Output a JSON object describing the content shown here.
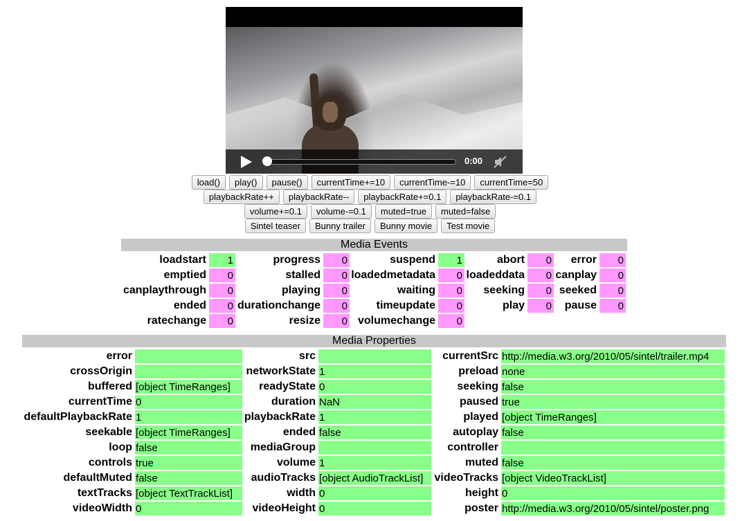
{
  "video": {
    "time": "0:00"
  },
  "buttons": {
    "row1": [
      "load()",
      "play()",
      "pause()",
      "currentTime+=10",
      "currentTime-=10",
      "currentTime=50"
    ],
    "row2": [
      "playbackRate++",
      "playbackRate--",
      "playbackRate+=0.1",
      "playbackRate-=0.1"
    ],
    "row3": [
      "volume+=0.1",
      "volume-=0.1",
      "muted=true",
      "muted=false"
    ],
    "row4": [
      "Sintel teaser",
      "Bunny trailer",
      "Bunny movie",
      "Test movie"
    ]
  },
  "events": {
    "title": "Media Events",
    "rows": [
      [
        [
          "loadstart",
          "1",
          "green"
        ],
        [
          "progress",
          "0",
          "pink"
        ],
        [
          "suspend",
          "1",
          "green"
        ],
        [
          "abort",
          "0",
          "pink"
        ],
        [
          "error",
          "0",
          "pink"
        ]
      ],
      [
        [
          "emptied",
          "0",
          "pink"
        ],
        [
          "stalled",
          "0",
          "pink"
        ],
        [
          "loadedmetadata",
          "0",
          "pink"
        ],
        [
          "loadeddata",
          "0",
          "pink"
        ],
        [
          "canplay",
          "0",
          "pink"
        ]
      ],
      [
        [
          "canplaythrough",
          "0",
          "pink"
        ],
        [
          "playing",
          "0",
          "pink"
        ],
        [
          "waiting",
          "0",
          "pink"
        ],
        [
          "seeking",
          "0",
          "pink"
        ],
        [
          "seeked",
          "0",
          "pink"
        ]
      ],
      [
        [
          "ended",
          "0",
          "pink"
        ],
        [
          "durationchange",
          "0",
          "pink"
        ],
        [
          "timeupdate",
          "0",
          "pink"
        ],
        [
          "play",
          "0",
          "pink"
        ],
        [
          "pause",
          "0",
          "pink"
        ]
      ],
      [
        [
          "ratechange",
          "0",
          "pink"
        ],
        [
          "resize",
          "0",
          "pink"
        ],
        [
          "volumechange",
          "0",
          "pink"
        ]
      ]
    ]
  },
  "properties": {
    "title": "Media Properties",
    "rows": [
      [
        [
          "error",
          ""
        ],
        [
          "src",
          ""
        ],
        [
          "currentSrc",
          "http://media.w3.org/2010/05/sintel/trailer.mp4"
        ]
      ],
      [
        [
          "crossOrigin",
          ""
        ],
        [
          "networkState",
          "1"
        ],
        [
          "preload",
          "none"
        ]
      ],
      [
        [
          "buffered",
          "[object TimeRanges]"
        ],
        [
          "readyState",
          "0"
        ],
        [
          "seeking",
          "false"
        ]
      ],
      [
        [
          "currentTime",
          "0"
        ],
        [
          "duration",
          "NaN"
        ],
        [
          "paused",
          "true"
        ]
      ],
      [
        [
          "defaultPlaybackRate",
          "1"
        ],
        [
          "playbackRate",
          "1"
        ],
        [
          "played",
          "[object TimeRanges]"
        ]
      ],
      [
        [
          "seekable",
          "[object TimeRanges]"
        ],
        [
          "ended",
          "false"
        ],
        [
          "autoplay",
          "false"
        ]
      ],
      [
        [
          "loop",
          "false"
        ],
        [
          "mediaGroup",
          ""
        ],
        [
          "controller",
          ""
        ]
      ],
      [
        [
          "controls",
          "true"
        ],
        [
          "volume",
          "1"
        ],
        [
          "muted",
          "false"
        ]
      ],
      [
        [
          "defaultMuted",
          "false"
        ],
        [
          "audioTracks",
          "[object AudioTrackList]"
        ],
        [
          "videoTracks",
          "[object VideoTrackList]"
        ]
      ],
      [
        [
          "textTracks",
          "[object TextTrackList]"
        ],
        [
          "width",
          "0"
        ],
        [
          "height",
          "0"
        ]
      ],
      [
        [
          "videoWidth",
          "0"
        ],
        [
          "videoHeight",
          "0"
        ],
        [
          "poster",
          "http://media.w3.org/2010/05/sintel/poster.png"
        ]
      ]
    ]
  }
}
